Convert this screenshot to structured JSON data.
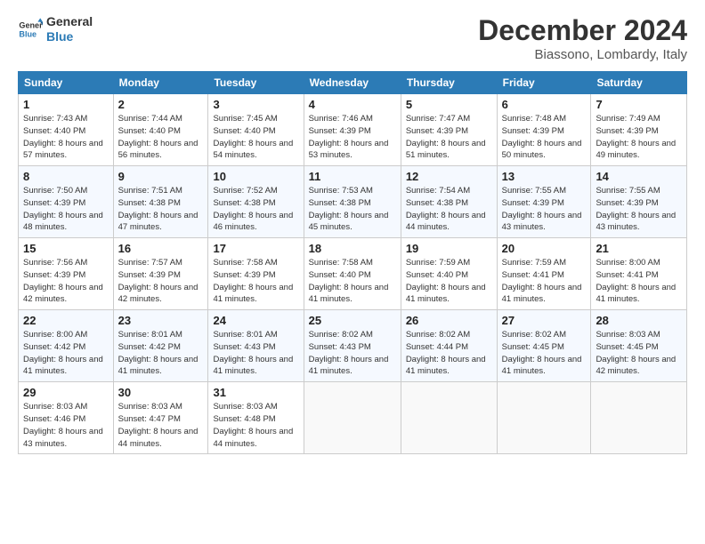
{
  "logo": {
    "line1": "General",
    "line2": "Blue"
  },
  "title": "December 2024",
  "subtitle": "Biassono, Lombardy, Italy",
  "weekdays": [
    "Sunday",
    "Monday",
    "Tuesday",
    "Wednesday",
    "Thursday",
    "Friday",
    "Saturday"
  ],
  "weeks": [
    [
      {
        "day": "1",
        "sunrise": "7:43 AM",
        "sunset": "4:40 PM",
        "daylight": "8 hours and 57 minutes."
      },
      {
        "day": "2",
        "sunrise": "7:44 AM",
        "sunset": "4:40 PM",
        "daylight": "8 hours and 56 minutes."
      },
      {
        "day": "3",
        "sunrise": "7:45 AM",
        "sunset": "4:40 PM",
        "daylight": "8 hours and 54 minutes."
      },
      {
        "day": "4",
        "sunrise": "7:46 AM",
        "sunset": "4:39 PM",
        "daylight": "8 hours and 53 minutes."
      },
      {
        "day": "5",
        "sunrise": "7:47 AM",
        "sunset": "4:39 PM",
        "daylight": "8 hours and 51 minutes."
      },
      {
        "day": "6",
        "sunrise": "7:48 AM",
        "sunset": "4:39 PM",
        "daylight": "8 hours and 50 minutes."
      },
      {
        "day": "7",
        "sunrise": "7:49 AM",
        "sunset": "4:39 PM",
        "daylight": "8 hours and 49 minutes."
      }
    ],
    [
      {
        "day": "8",
        "sunrise": "7:50 AM",
        "sunset": "4:39 PM",
        "daylight": "8 hours and 48 minutes."
      },
      {
        "day": "9",
        "sunrise": "7:51 AM",
        "sunset": "4:38 PM",
        "daylight": "8 hours and 47 minutes."
      },
      {
        "day": "10",
        "sunrise": "7:52 AM",
        "sunset": "4:38 PM",
        "daylight": "8 hours and 46 minutes."
      },
      {
        "day": "11",
        "sunrise": "7:53 AM",
        "sunset": "4:38 PM",
        "daylight": "8 hours and 45 minutes."
      },
      {
        "day": "12",
        "sunrise": "7:54 AM",
        "sunset": "4:38 PM",
        "daylight": "8 hours and 44 minutes."
      },
      {
        "day": "13",
        "sunrise": "7:55 AM",
        "sunset": "4:39 PM",
        "daylight": "8 hours and 43 minutes."
      },
      {
        "day": "14",
        "sunrise": "7:55 AM",
        "sunset": "4:39 PM",
        "daylight": "8 hours and 43 minutes."
      }
    ],
    [
      {
        "day": "15",
        "sunrise": "7:56 AM",
        "sunset": "4:39 PM",
        "daylight": "8 hours and 42 minutes."
      },
      {
        "day": "16",
        "sunrise": "7:57 AM",
        "sunset": "4:39 PM",
        "daylight": "8 hours and 42 minutes."
      },
      {
        "day": "17",
        "sunrise": "7:58 AM",
        "sunset": "4:39 PM",
        "daylight": "8 hours and 41 minutes."
      },
      {
        "day": "18",
        "sunrise": "7:58 AM",
        "sunset": "4:40 PM",
        "daylight": "8 hours and 41 minutes."
      },
      {
        "day": "19",
        "sunrise": "7:59 AM",
        "sunset": "4:40 PM",
        "daylight": "8 hours and 41 minutes."
      },
      {
        "day": "20",
        "sunrise": "7:59 AM",
        "sunset": "4:41 PM",
        "daylight": "8 hours and 41 minutes."
      },
      {
        "day": "21",
        "sunrise": "8:00 AM",
        "sunset": "4:41 PM",
        "daylight": "8 hours and 41 minutes."
      }
    ],
    [
      {
        "day": "22",
        "sunrise": "8:00 AM",
        "sunset": "4:42 PM",
        "daylight": "8 hours and 41 minutes."
      },
      {
        "day": "23",
        "sunrise": "8:01 AM",
        "sunset": "4:42 PM",
        "daylight": "8 hours and 41 minutes."
      },
      {
        "day": "24",
        "sunrise": "8:01 AM",
        "sunset": "4:43 PM",
        "daylight": "8 hours and 41 minutes."
      },
      {
        "day": "25",
        "sunrise": "8:02 AM",
        "sunset": "4:43 PM",
        "daylight": "8 hours and 41 minutes."
      },
      {
        "day": "26",
        "sunrise": "8:02 AM",
        "sunset": "4:44 PM",
        "daylight": "8 hours and 41 minutes."
      },
      {
        "day": "27",
        "sunrise": "8:02 AM",
        "sunset": "4:45 PM",
        "daylight": "8 hours and 41 minutes."
      },
      {
        "day": "28",
        "sunrise": "8:03 AM",
        "sunset": "4:45 PM",
        "daylight": "8 hours and 42 minutes."
      }
    ],
    [
      {
        "day": "29",
        "sunrise": "8:03 AM",
        "sunset": "4:46 PM",
        "daylight": "8 hours and 43 minutes."
      },
      {
        "day": "30",
        "sunrise": "8:03 AM",
        "sunset": "4:47 PM",
        "daylight": "8 hours and 44 minutes."
      },
      {
        "day": "31",
        "sunrise": "8:03 AM",
        "sunset": "4:48 PM",
        "daylight": "8 hours and 44 minutes."
      },
      null,
      null,
      null,
      null
    ]
  ]
}
